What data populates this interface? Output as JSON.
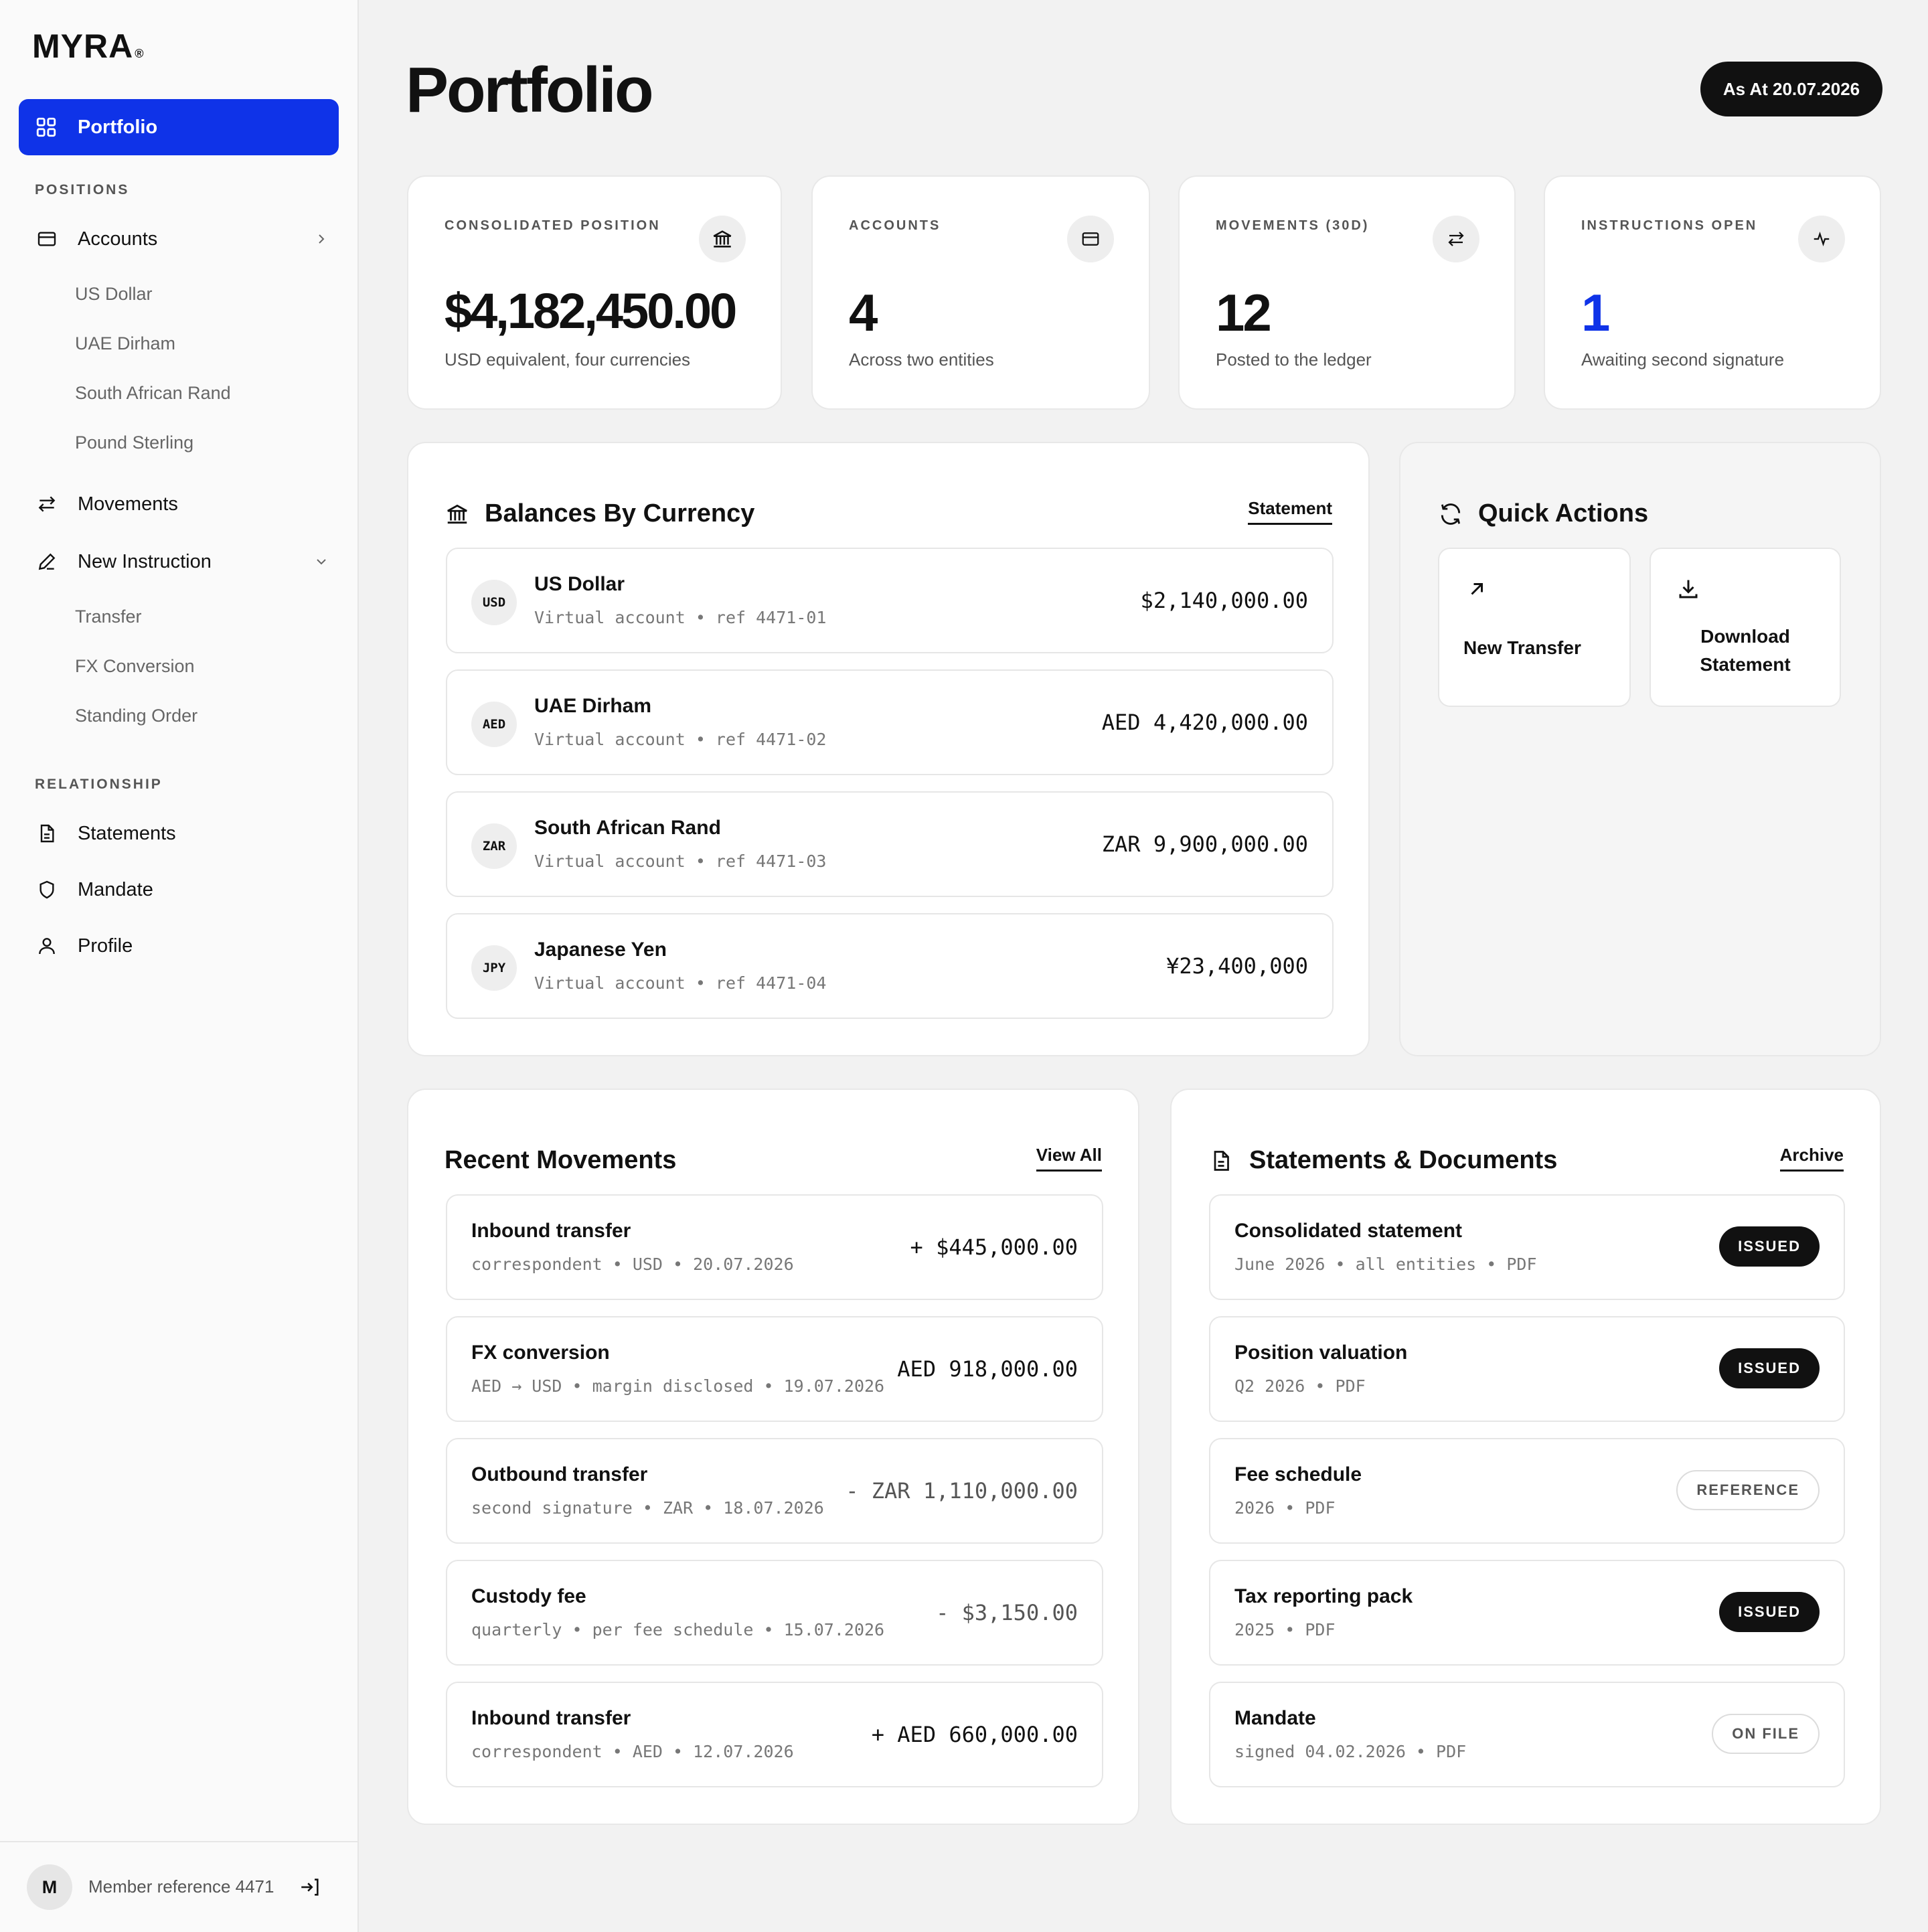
{
  "brand": {
    "name": "MYRA",
    "mark": "®"
  },
  "sidebar": {
    "active": {
      "label": "Portfolio",
      "icon": "grid-icon"
    },
    "positions_label": "POSITIONS",
    "accounts": {
      "label": "Accounts",
      "icon": "card-icon",
      "subitems": [
        "US Dollar",
        "UAE Dirham",
        "South African Rand",
        "Pound Sterling"
      ]
    },
    "movements": {
      "label": "Movements",
      "icon": "arrows-icon"
    },
    "new_instruction": {
      "label": "New Instruction",
      "icon": "pen-icon",
      "subitems": [
        "Transfer",
        "FX Conversion",
        "Standing Order"
      ]
    },
    "relationship_label": "RELATIONSHIP",
    "statements": {
      "label": "Statements",
      "icon": "document-icon"
    },
    "mandate": {
      "label": "Mandate",
      "icon": "shield-icon"
    },
    "profile": {
      "label": "Profile",
      "icon": "user-icon"
    },
    "footer": {
      "avatar": "M",
      "member_ref": "Member reference 4471"
    }
  },
  "header": {
    "title": "Portfolio",
    "as_at": "As At 20.07.2026"
  },
  "stats": [
    {
      "label": "CONSOLIDATED POSITION",
      "value": "$4,182,450.00",
      "sub": "USD equivalent, four currencies",
      "icon": "bank-icon"
    },
    {
      "label": "ACCOUNTS",
      "value": "4",
      "sub": "Across two entities",
      "icon": "card-icon"
    },
    {
      "label": "MOVEMENTS (30D)",
      "value": "12",
      "sub": "Posted to the ledger",
      "icon": "arrows-icon"
    },
    {
      "label": "INSTRUCTIONS OPEN",
      "value": "1",
      "sub": "Awaiting second signature",
      "icon": "pulse-icon",
      "accent": "#0f33e8"
    }
  ],
  "balances": {
    "title": "Balances By Currency",
    "link": "Statement",
    "rows": [
      {
        "code": "USD",
        "name": "US Dollar",
        "meta": "Virtual account • ref 4471-01",
        "amount": "$2,140,000.00"
      },
      {
        "code": "AED",
        "name": "UAE Dirham",
        "meta": "Virtual account • ref 4471-02",
        "amount": "AED 4,420,000.00"
      },
      {
        "code": "ZAR",
        "name": "South African Rand",
        "meta": "Virtual account • ref 4471-03",
        "amount": "ZAR 9,900,000.00"
      },
      {
        "code": "JPY",
        "name": "Japanese Yen",
        "meta": "Virtual account • ref 4471-04",
        "amount": "¥23,400,000"
      }
    ]
  },
  "quick_actions": {
    "title": "Quick Actions",
    "tiles": [
      {
        "label": "New Transfer",
        "icon": "arrow-up-right-icon"
      },
      {
        "label_line1": "Download",
        "label_line2": "Statement",
        "icon": "download-icon"
      }
    ]
  },
  "movements": {
    "title": "Recent Movements",
    "link": "View All",
    "rows": [
      {
        "title": "Inbound transfer",
        "meta": "correspondent • USD • 20.07.2026",
        "amount": "+ $445,000.00"
      },
      {
        "title": "FX conversion",
        "meta": "AED → USD • margin disclosed • 19.07.2026",
        "amount": "AED 918,000.00"
      },
      {
        "title": "Outbound transfer",
        "meta": "second signature • ZAR • 18.07.2026",
        "amount": "- ZAR 1,110,000.00"
      },
      {
        "title": "Custody fee",
        "meta": "quarterly • per fee schedule • 15.07.2026",
        "amount": "- $3,150.00"
      },
      {
        "title": "Inbound transfer",
        "meta": "correspondent • AED • 12.07.2026",
        "amount": "+ AED 660,000.00"
      }
    ]
  },
  "documents": {
    "title": "Statements & Documents",
    "link": "Archive",
    "rows": [
      {
        "title": "Consolidated statement",
        "meta": "June 2026 • all entities • PDF",
        "status": "ISSUED"
      },
      {
        "title": "Position valuation",
        "meta": "Q2 2026 • PDF",
        "status": "ISSUED"
      },
      {
        "title": "Fee schedule",
        "meta": "2026 • PDF",
        "status": "REFERENCE"
      },
      {
        "title": "Tax reporting pack",
        "meta": "2025 • PDF",
        "status": "ISSUED"
      },
      {
        "title": "Mandate",
        "meta": "signed 04.02.2026 • PDF",
        "status": "ON FILE"
      }
    ]
  }
}
